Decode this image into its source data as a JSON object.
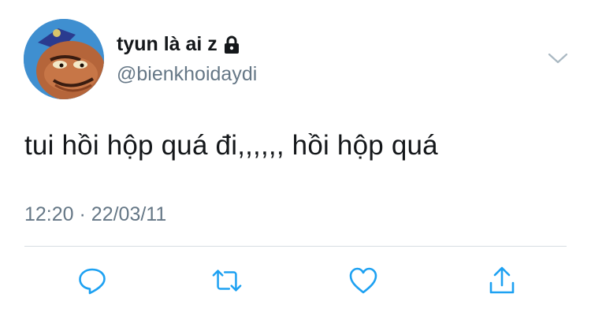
{
  "tweet": {
    "display_name": "tyun là ai z",
    "handle": "@bienkhoidaydi",
    "text": "tui hồi hộp quá đi,,,,,, hồi hộp quá",
    "time": "12:20",
    "separator": "·",
    "date": "22/03/11"
  },
  "icons": {
    "lock": "lock-icon",
    "caret": "chevron-down-icon",
    "reply": "reply-icon",
    "retweet": "retweet-icon",
    "like": "heart-icon",
    "share": "share-icon"
  },
  "colors": {
    "text": "#14171a",
    "secondary": "#657786",
    "icon": "#1da1f2",
    "divider": "#d7dee3"
  }
}
